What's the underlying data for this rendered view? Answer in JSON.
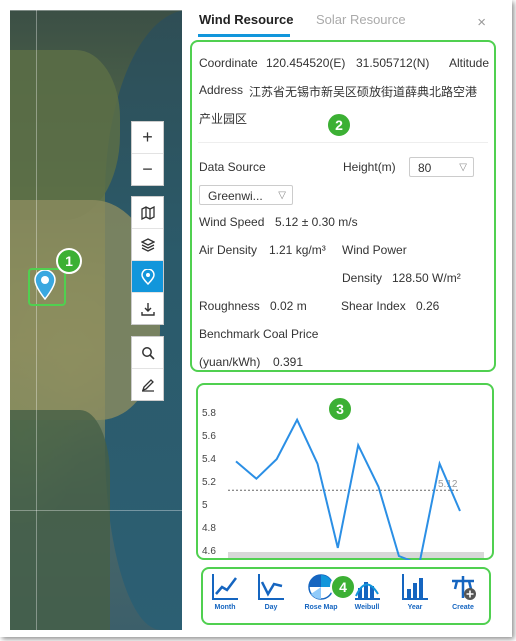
{
  "tabs": {
    "wind": "Wind Resource",
    "solar": "Solar Resource",
    "close": "×"
  },
  "info": {
    "coordinate_label": "Coordinate",
    "coordinate_lon": "120.454520(E)",
    "coordinate_lat": "31.505712(N)",
    "altitude_label": "Altitude",
    "address_label": "Address",
    "address_line1": "江苏省无锡市新吴区硕放街道薛典北路空港",
    "address_line2": "产业园区",
    "data_source_label": "Data Source",
    "data_source_value": "Greenwi...",
    "height_label": "Height(m)",
    "height_value": "80",
    "wind_speed_label": "Wind Speed",
    "wind_speed_value": "5.12 ± 0.30 m/s",
    "air_density_label": "Air Density",
    "air_density_value": "1.21 kg/m³",
    "wind_power_label": "Wind Power",
    "wind_power_density_label": "Density",
    "wind_power_density_value": "128.50 W/m²",
    "roughness_label": "Roughness",
    "roughness_value": "0.02 m",
    "shear_label": "Shear Index",
    "shear_value": "0.26",
    "coal_label": "Benchmark Coal Price",
    "coal_unit": "(yuan/kWh)",
    "coal_value": "0.391"
  },
  "badges": [
    "1",
    "2",
    "3",
    "4"
  ],
  "map_tools": [
    {
      "icon": "zoom-in-icon",
      "glyph": "+",
      "active": false
    },
    {
      "icon": "zoom-out-icon",
      "glyph": "−",
      "active": false
    },
    {
      "icon": "map-icon",
      "glyph": "▥",
      "active": false
    },
    {
      "icon": "layers-icon",
      "glyph": "◈",
      "active": false
    },
    {
      "icon": "location-pin-icon",
      "glyph": "⚲",
      "active": true
    },
    {
      "icon": "download-icon",
      "glyph": "⤓",
      "active": false
    },
    {
      "icon": "search-icon",
      "glyph": "⌕",
      "active": false
    },
    {
      "icon": "edit-icon",
      "glyph": "✎",
      "active": false
    }
  ],
  "bottom_buttons": [
    {
      "label": "Month",
      "icon": "month-chart-icon"
    },
    {
      "label": "Day",
      "icon": "day-chart-icon"
    },
    {
      "label": "Rose Map",
      "icon": "rose-map-icon"
    },
    {
      "label": "Weibull",
      "icon": "weibull-icon"
    },
    {
      "label": "Year",
      "icon": "year-chart-icon"
    },
    {
      "label": "Create",
      "icon": "create-icon"
    }
  ],
  "colors": {
    "accent": "#1296db",
    "highlight": "#50d050",
    "badge": "#3cb034"
  },
  "chart_data": {
    "type": "line",
    "y_ticks": [
      "5.8",
      "5.6",
      "5.4",
      "5.2",
      "5",
      "4.8",
      "4.6"
    ],
    "ylim": [
      4.55,
      5.85
    ],
    "x": [
      1,
      2,
      3,
      4,
      5,
      6,
      7,
      8,
      9,
      10,
      11,
      12
    ],
    "values": [
      5.37,
      5.22,
      5.39,
      5.73,
      5.35,
      4.62,
      5.51,
      5.15,
      4.55,
      4.48,
      5.35,
      4.94
    ],
    "mean_line": 5.12,
    "mean_label": "5.12"
  }
}
